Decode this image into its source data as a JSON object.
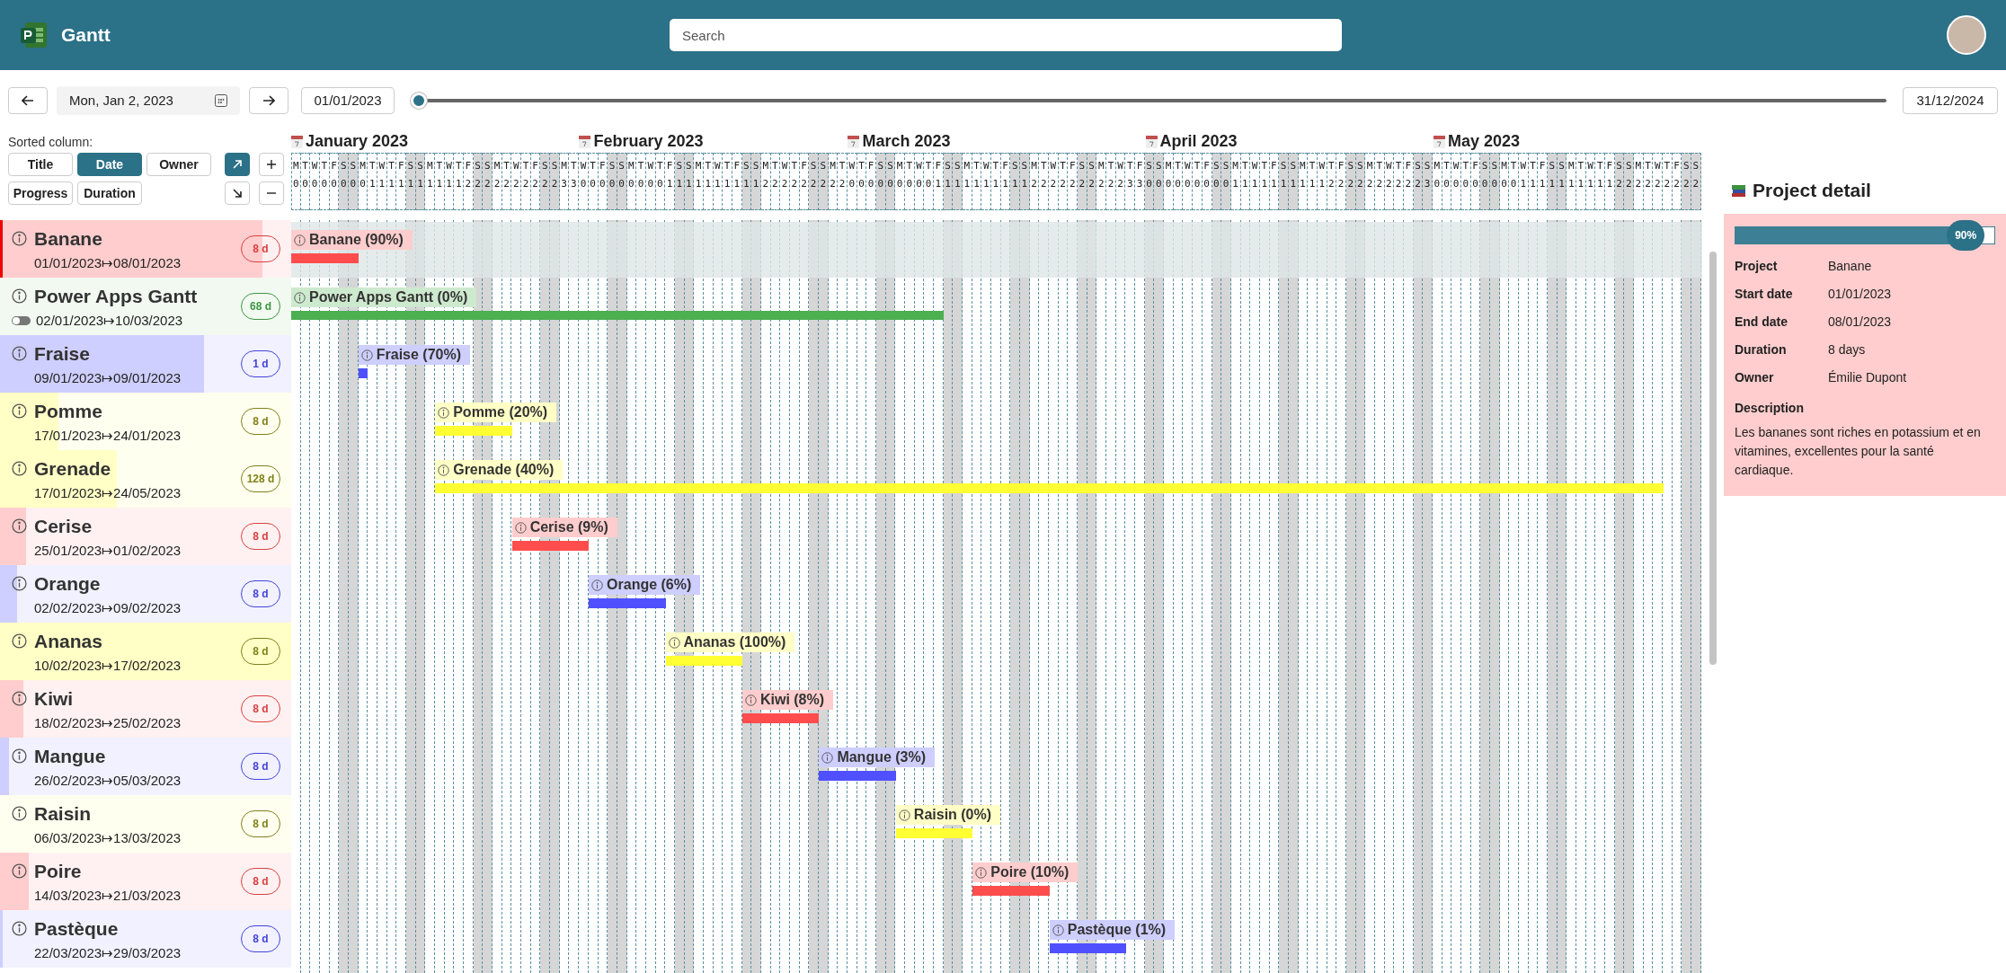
{
  "header": {
    "app_title": "Gantt",
    "search": {
      "placeholder": "Search"
    }
  },
  "toolbar": {
    "current_date": "Mon, Jan 2, 2023",
    "range_start": "01/01/2023",
    "range_end": "31/12/2024",
    "range_slider": {
      "level": 0
    }
  },
  "sort": {
    "label": "Sorted column:",
    "columns": [
      {
        "label": "Title",
        "selected": false
      },
      {
        "label": "Date",
        "selected": true
      },
      {
        "label": "Owner",
        "selected": false
      },
      {
        "label": "Progress",
        "selected": false
      },
      {
        "label": "Duration",
        "selected": false
      }
    ],
    "directions": [
      {
        "kind": "ascending",
        "selected": true
      },
      {
        "kind": "descending",
        "selected": false
      }
    ]
  },
  "timeline": {
    "days": [
      {
        "month": "January 2023",
        "letter": "M",
        "digit": "0",
        "weekend": false
      },
      {
        "letter": "T",
        "digit": "0",
        "weekend": false
      },
      {
        "letter": "W",
        "digit": "0",
        "weekend": false
      },
      {
        "letter": "T",
        "digit": "0",
        "weekend": false
      },
      {
        "letter": "F",
        "digit": "0",
        "weekend": false
      },
      {
        "letter": "S",
        "digit": "0",
        "weekend": true
      },
      {
        "letter": "S",
        "digit": "0",
        "weekend": true
      },
      {
        "letter": "M",
        "digit": "0",
        "weekend": false
      },
      {
        "letter": "T",
        "digit": "1",
        "weekend": false
      },
      {
        "letter": "W",
        "digit": "1",
        "weekend": false
      },
      {
        "letter": "T",
        "digit": "1",
        "weekend": false
      },
      {
        "letter": "F",
        "digit": "1",
        "weekend": false
      },
      {
        "letter": "S",
        "digit": "1",
        "weekend": true
      },
      {
        "letter": "S",
        "digit": "1",
        "weekend": true
      },
      {
        "letter": "M",
        "digit": "1",
        "weekend": false
      },
      {
        "letter": "T",
        "digit": "1",
        "weekend": false
      },
      {
        "letter": "W",
        "digit": "1",
        "weekend": false
      },
      {
        "letter": "T",
        "digit": "1",
        "weekend": false
      },
      {
        "letter": "F",
        "digit": "2",
        "weekend": false
      },
      {
        "letter": "S",
        "digit": "2",
        "weekend": true
      },
      {
        "letter": "S",
        "digit": "2",
        "weekend": true
      },
      {
        "letter": "M",
        "digit": "2",
        "weekend": false
      },
      {
        "letter": "T",
        "digit": "2",
        "weekend": false
      },
      {
        "letter": "W",
        "digit": "2",
        "weekend": false
      },
      {
        "letter": "T",
        "digit": "2",
        "weekend": false
      },
      {
        "letter": "F",
        "digit": "2",
        "weekend": false
      },
      {
        "letter": "S",
        "digit": "2",
        "weekend": true
      },
      {
        "letter": "S",
        "digit": "2",
        "weekend": true
      },
      {
        "letter": "M",
        "digit": "3",
        "weekend": false
      },
      {
        "letter": "T",
        "digit": "3",
        "weekend": false
      },
      {
        "month": "February 2023",
        "letter": "W",
        "digit": "0",
        "weekend": false
      },
      {
        "letter": "T",
        "digit": "0",
        "weekend": false
      },
      {
        "letter": "F",
        "digit": "0",
        "weekend": false
      },
      {
        "letter": "S",
        "digit": "0",
        "weekend": true
      },
      {
        "letter": "S",
        "digit": "0",
        "weekend": true
      },
      {
        "letter": "M",
        "digit": "0",
        "weekend": false
      },
      {
        "letter": "T",
        "digit": "0",
        "weekend": false
      },
      {
        "letter": "W",
        "digit": "0",
        "weekend": false
      },
      {
        "letter": "T",
        "digit": "0",
        "weekend": false
      },
      {
        "letter": "F",
        "digit": "1",
        "weekend": false
      },
      {
        "letter": "S",
        "digit": "1",
        "weekend": true
      },
      {
        "letter": "S",
        "digit": "1",
        "weekend": true
      },
      {
        "letter": "M",
        "digit": "1",
        "weekend": false
      },
      {
        "letter": "T",
        "digit": "1",
        "weekend": false
      },
      {
        "letter": "W",
        "digit": "1",
        "weekend": false
      },
      {
        "letter": "T",
        "digit": "1",
        "weekend": false
      },
      {
        "letter": "F",
        "digit": "1",
        "weekend": false
      },
      {
        "letter": "S",
        "digit": "1",
        "weekend": true
      },
      {
        "letter": "S",
        "digit": "1",
        "weekend": true
      },
      {
        "letter": "M",
        "digit": "2",
        "weekend": false
      },
      {
        "letter": "T",
        "digit": "2",
        "weekend": false
      },
      {
        "letter": "W",
        "digit": "2",
        "weekend": false
      },
      {
        "letter": "T",
        "digit": "2",
        "weekend": false
      },
      {
        "letter": "F",
        "digit": "2",
        "weekend": false
      },
      {
        "letter": "S",
        "digit": "2",
        "weekend": true
      },
      {
        "letter": "S",
        "digit": "2",
        "weekend": true
      },
      {
        "letter": "M",
        "digit": "2",
        "weekend": false
      },
      {
        "letter": "T",
        "digit": "2",
        "weekend": false
      },
      {
        "month": "March 2023",
        "letter": "W",
        "digit": "0",
        "weekend": false
      },
      {
        "letter": "T",
        "digit": "0",
        "weekend": false
      },
      {
        "letter": "F",
        "digit": "0",
        "weekend": false
      },
      {
        "letter": "S",
        "digit": "0",
        "weekend": true
      },
      {
        "letter": "S",
        "digit": "0",
        "weekend": true
      },
      {
        "letter": "M",
        "digit": "0",
        "weekend": false
      },
      {
        "letter": "T",
        "digit": "0",
        "weekend": false
      },
      {
        "letter": "W",
        "digit": "0",
        "weekend": false
      },
      {
        "letter": "T",
        "digit": "0",
        "weekend": false
      },
      {
        "letter": "F",
        "digit": "1",
        "weekend": false
      },
      {
        "letter": "S",
        "digit": "1",
        "weekend": true
      },
      {
        "letter": "S",
        "digit": "1",
        "weekend": true
      },
      {
        "letter": "M",
        "digit": "1",
        "weekend": false
      },
      {
        "letter": "T",
        "digit": "1",
        "weekend": false
      },
      {
        "letter": "W",
        "digit": "1",
        "weekend": false
      },
      {
        "letter": "T",
        "digit": "1",
        "weekend": false
      },
      {
        "letter": "F",
        "digit": "1",
        "weekend": false
      },
      {
        "letter": "S",
        "digit": "1",
        "weekend": true
      },
      {
        "letter": "S",
        "digit": "1",
        "weekend": true
      },
      {
        "letter": "M",
        "digit": "2",
        "weekend": false
      },
      {
        "letter": "T",
        "digit": "2",
        "weekend": false
      },
      {
        "letter": "W",
        "digit": "2",
        "weekend": false
      },
      {
        "letter": "T",
        "digit": "2",
        "weekend": false
      },
      {
        "letter": "F",
        "digit": "2",
        "weekend": false
      },
      {
        "letter": "S",
        "digit": "2",
        "weekend": true
      },
      {
        "letter": "S",
        "digit": "2",
        "weekend": true
      },
      {
        "letter": "M",
        "digit": "2",
        "weekend": false
      },
      {
        "letter": "T",
        "digit": "2",
        "weekend": false
      },
      {
        "letter": "W",
        "digit": "2",
        "weekend": false
      },
      {
        "letter": "T",
        "digit": "3",
        "weekend": false
      },
      {
        "letter": "F",
        "digit": "3",
        "weekend": false
      },
      {
        "month": "April 2023",
        "letter": "S",
        "digit": "0",
        "weekend": true
      },
      {
        "letter": "S",
        "digit": "0",
        "weekend": true
      },
      {
        "letter": "M",
        "digit": "0",
        "weekend": false
      },
      {
        "letter": "T",
        "digit": "0",
        "weekend": false
      },
      {
        "letter": "W",
        "digit": "0",
        "weekend": false
      },
      {
        "letter": "T",
        "digit": "0",
        "weekend": false
      },
      {
        "letter": "F",
        "digit": "0",
        "weekend": false
      },
      {
        "letter": "S",
        "digit": "0",
        "weekend": true
      },
      {
        "letter": "S",
        "digit": "0",
        "weekend": true
      },
      {
        "letter": "M",
        "digit": "1",
        "weekend": false
      },
      {
        "letter": "T",
        "digit": "1",
        "weekend": false
      },
      {
        "letter": "W",
        "digit": "1",
        "weekend": false
      },
      {
        "letter": "T",
        "digit": "1",
        "weekend": false
      },
      {
        "letter": "F",
        "digit": "1",
        "weekend": false
      },
      {
        "letter": "S",
        "digit": "1",
        "weekend": true
      },
      {
        "letter": "S",
        "digit": "1",
        "weekend": true
      },
      {
        "letter": "M",
        "digit": "1",
        "weekend": false
      },
      {
        "letter": "T",
        "digit": "1",
        "weekend": false
      },
      {
        "letter": "W",
        "digit": "1",
        "weekend": false
      },
      {
        "letter": "T",
        "digit": "2",
        "weekend": false
      },
      {
        "letter": "F",
        "digit": "2",
        "weekend": false
      },
      {
        "letter": "S",
        "digit": "2",
        "weekend": true
      },
      {
        "letter": "S",
        "digit": "2",
        "weekend": true
      },
      {
        "letter": "M",
        "digit": "2",
        "weekend": false
      },
      {
        "letter": "T",
        "digit": "2",
        "weekend": false
      },
      {
        "letter": "W",
        "digit": "2",
        "weekend": false
      },
      {
        "letter": "T",
        "digit": "2",
        "weekend": false
      },
      {
        "letter": "F",
        "digit": "2",
        "weekend": false
      },
      {
        "letter": "S",
        "digit": "2",
        "weekend": true
      },
      {
        "letter": "S",
        "digit": "3",
        "weekend": true
      },
      {
        "month": "May 2023",
        "letter": "M",
        "digit": "0",
        "weekend": false
      },
      {
        "letter": "T",
        "digit": "0",
        "weekend": false
      },
      {
        "letter": "W",
        "digit": "0",
        "weekend": false
      },
      {
        "letter": "T",
        "digit": "0",
        "weekend": false
      },
      {
        "letter": "F",
        "digit": "0",
        "weekend": false
      },
      {
        "letter": "S",
        "digit": "0",
        "weekend": true
      },
      {
        "letter": "S",
        "digit": "0",
        "weekend": true
      },
      {
        "letter": "M",
        "digit": "0",
        "weekend": false
      },
      {
        "letter": "T",
        "digit": "0",
        "weekend": false
      },
      {
        "letter": "W",
        "digit": "1",
        "weekend": false
      },
      {
        "letter": "T",
        "digit": "1",
        "weekend": false
      },
      {
        "letter": "F",
        "digit": "1",
        "weekend": false
      },
      {
        "letter": "S",
        "digit": "1",
        "weekend": true
      },
      {
        "letter": "S",
        "digit": "1",
        "weekend": true
      },
      {
        "letter": "M",
        "digit": "1",
        "weekend": false
      },
      {
        "letter": "T",
        "digit": "1",
        "weekend": false
      },
      {
        "letter": "W",
        "digit": "1",
        "weekend": false
      },
      {
        "letter": "T",
        "digit": "1",
        "weekend": false
      },
      {
        "letter": "F",
        "digit": "1",
        "weekend": false
      },
      {
        "letter": "S",
        "digit": "2",
        "weekend": true
      },
      {
        "letter": "S",
        "digit": "2",
        "weekend": true
      },
      {
        "letter": "M",
        "digit": "2",
        "weekend": false
      },
      {
        "letter": "T",
        "digit": "2",
        "weekend": false
      },
      {
        "letter": "W",
        "digit": "2",
        "weekend": false
      },
      {
        "letter": "T",
        "digit": "2",
        "weekend": false
      },
      {
        "letter": "F",
        "digit": "2",
        "weekend": false
      },
      {
        "letter": "S",
        "digit": "2",
        "weekend": true
      },
      {
        "letter": "S",
        "digit": "2",
        "weekend": true
      }
    ]
  },
  "tasks": [
    {
      "kind": "task",
      "title": "Banane",
      "start": "01/01/2023",
      "end": "08/01/2023",
      "duration": "8 d",
      "bar_label": "Banane (90%)",
      "level": 0.9,
      "color": "#ff4d4d",
      "selected": true
    },
    {
      "kind": "summary",
      "title": "Power Apps Gantt",
      "start": "02/01/2023",
      "end": "10/03/2023",
      "duration": "68 d",
      "bar_label": "Power Apps Gantt (0%)",
      "level": 0,
      "color": "#4caf50",
      "selected": false,
      "expanded": false
    },
    {
      "kind": "task",
      "title": "Fraise",
      "start": "09/01/2023",
      "end": "09/01/2023",
      "duration": "1 d",
      "bar_label": "Fraise (70%)",
      "level": 0.7,
      "color": "#5050ff",
      "selected": false
    },
    {
      "kind": "task",
      "title": "Pomme",
      "start": "17/01/2023",
      "end": "24/01/2023",
      "duration": "8 d",
      "bar_label": "Pomme (20%)",
      "level": 0.2,
      "color": "#ffff33",
      "selected": false
    },
    {
      "kind": "task",
      "title": "Grenade",
      "start": "17/01/2023",
      "end": "24/05/2023",
      "duration": "128 d",
      "bar_label": "Grenade (40%)",
      "level": 0.4,
      "color": "#ffff33",
      "selected": false
    },
    {
      "kind": "task",
      "title": "Cerise",
      "start": "25/01/2023",
      "end": "01/02/2023",
      "duration": "8 d",
      "bar_label": "Cerise (9%)",
      "level": 0.09,
      "color": "#ff4d4d",
      "selected": false
    },
    {
      "kind": "task",
      "title": "Orange",
      "start": "02/02/2023",
      "end": "09/02/2023",
      "duration": "8 d",
      "bar_label": "Orange (6%)",
      "level": 0.06,
      "color": "#5050ff",
      "selected": false
    },
    {
      "kind": "task",
      "title": "Ananas",
      "start": "10/02/2023",
      "end": "17/02/2023",
      "duration": "8 d",
      "bar_label": "Ananas (100%)",
      "level": 1,
      "color": "#ffff33",
      "selected": false
    },
    {
      "kind": "task",
      "title": "Kiwi",
      "start": "18/02/2023",
      "end": "25/02/2023",
      "duration": "8 d",
      "bar_label": "Kiwi (8%)",
      "level": 0.08,
      "color": "#ff4d4d",
      "selected": false
    },
    {
      "kind": "task",
      "title": "Mangue",
      "start": "26/02/2023",
      "end": "05/03/2023",
      "duration": "8 d",
      "bar_label": "Mangue (3%)",
      "level": 0.03,
      "color": "#5050ff",
      "selected": false
    },
    {
      "kind": "task",
      "title": "Raisin",
      "start": "06/03/2023",
      "end": "13/03/2023",
      "duration": "8 d",
      "bar_label": "Raisin (0%)",
      "level": 0,
      "color": "#ffff33",
      "selected": false
    },
    {
      "kind": "task",
      "title": "Poire",
      "start": "14/03/2023",
      "end": "21/03/2023",
      "duration": "8 d",
      "bar_label": "Poire (10%)",
      "level": 0.1,
      "color": "#ff4d4d",
      "selected": false
    },
    {
      "kind": "task",
      "title": "Pastèque",
      "start": "22/03/2023",
      "end": "29/03/2023",
      "duration": "8 d",
      "bar_label": "Pastèque (1%)",
      "level": 0.01,
      "color": "#5050ff",
      "selected": false
    }
  ],
  "date_separators": [
    "↦",
    "↦",
    "↦",
    "↦",
    "↦",
    "↦",
    "↦",
    "↦",
    "↦",
    "↦",
    "↦",
    "↦",
    "↦"
  ],
  "detail": {
    "title": "Project detail",
    "progress": {
      "level": 0.9,
      "label": "90%"
    },
    "fields": [
      {
        "label": "Project",
        "value": "Banane"
      },
      {
        "label": "Start date",
        "value": "01/01/2023"
      },
      {
        "label": "End date",
        "value": "08/01/2023"
      },
      {
        "label": "Duration",
        "value": "8 days"
      },
      {
        "label": "Owner",
        "value": "Émilie Dupont"
      }
    ],
    "description_label": "Description",
    "description": "Les bananes sont riches en potassium et en vitamines, excellentes pour la santé cardiaque."
  }
}
